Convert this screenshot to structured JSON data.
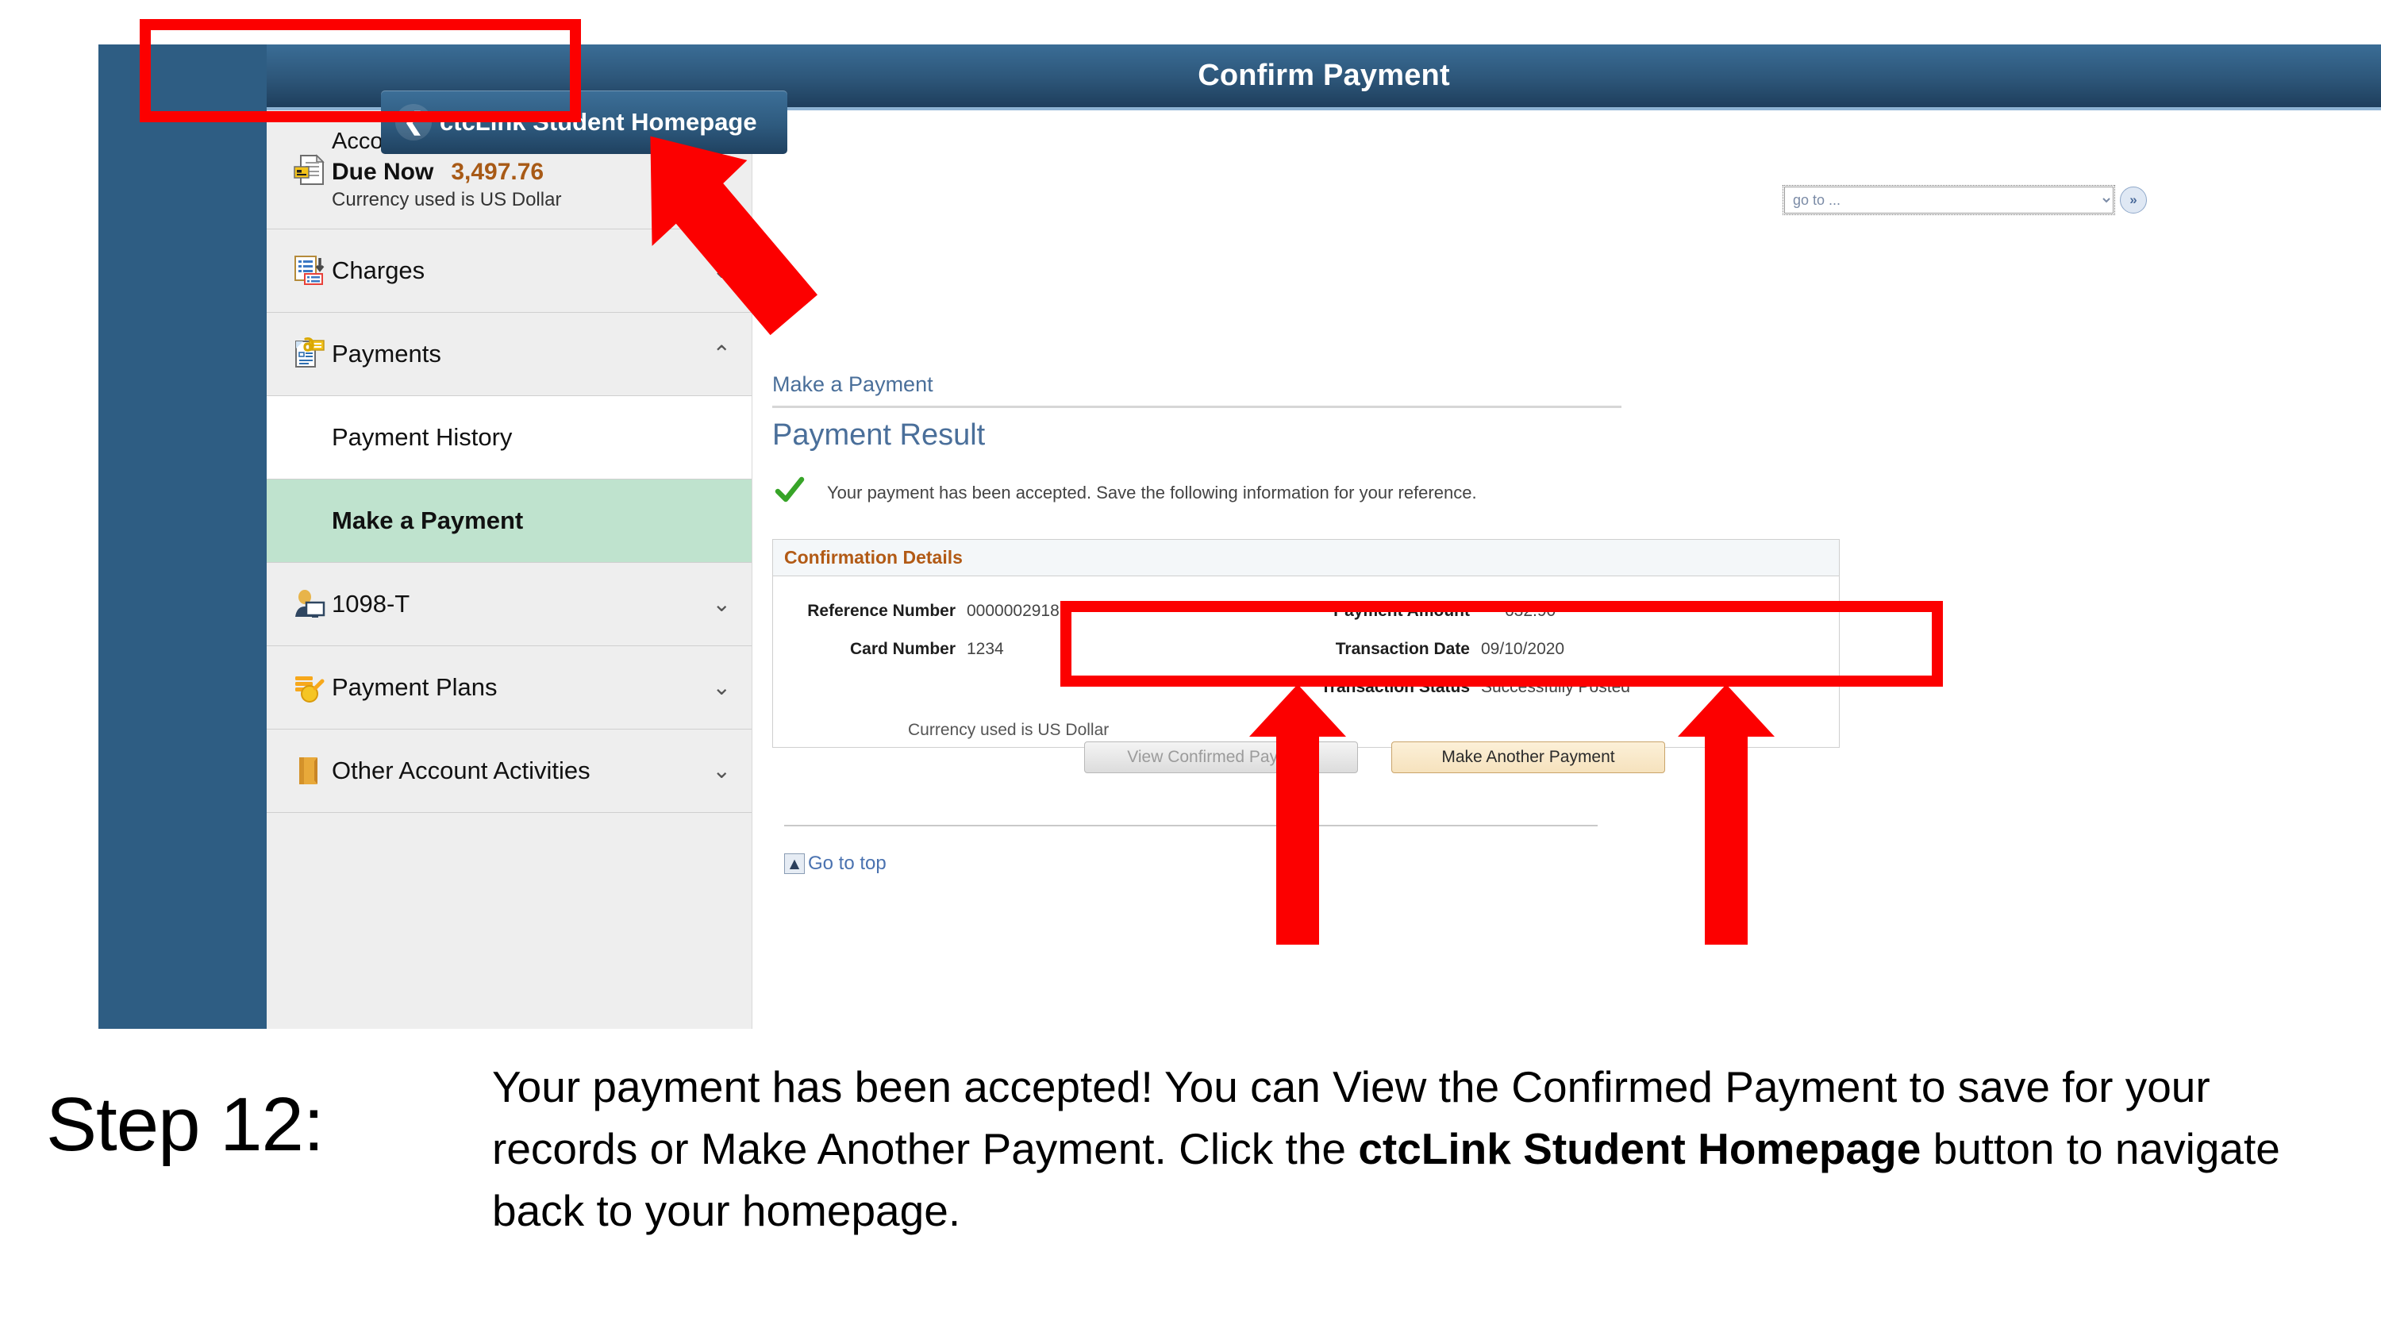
{
  "header": {
    "title": "Confirm Payment",
    "back_button_label": "ctcLink Student Homepage",
    "back_icon": "chevron-left-icon"
  },
  "sidebar": {
    "balance": {
      "title": "Account Balance",
      "due_label": "Due Now",
      "due_amount": "3,497.76",
      "currency_note": "Currency used is US Dollar",
      "icon": "invoice-icon",
      "amount_color": "#a85a16"
    },
    "items": [
      {
        "label": "Charges",
        "icon": "charges-list-icon",
        "chevron": "⌄",
        "expanded": false
      },
      {
        "label": "Payments",
        "icon": "payments-icon",
        "chevron": "⌃",
        "expanded": true
      },
      {
        "label": "1098-T",
        "icon": "person-monitor-icon",
        "chevron": "⌄",
        "expanded": false
      },
      {
        "label": "Payment Plans",
        "icon": "coins-stack-icon",
        "chevron": "⌄",
        "expanded": false
      },
      {
        "label": "Other Account Activities",
        "icon": "folder-icon",
        "chevron": "⌄",
        "expanded": false
      }
    ],
    "sub_items": [
      {
        "label": "Payment History",
        "active": false
      },
      {
        "label": "Make a Payment",
        "active": true
      }
    ],
    "active_highlight_color": "#bfe3ce"
  },
  "main": {
    "go_to": {
      "selected": "go to ...",
      "go_icon": "double-chevron-right-icon"
    },
    "breadcrumb": "Make a Payment",
    "page_title": "Payment Result",
    "status_icon": "green-check-icon",
    "status_message": "Your payment has been accepted. Save the following information for your reference.",
    "confirmation": {
      "panel_title": "Confirmation Details",
      "panel_title_color": "#b25a15",
      "left_fields": [
        {
          "label": "Reference Number",
          "value": "0000002918"
        },
        {
          "label": "Card Number",
          "value": "1234"
        }
      ],
      "right_fields": [
        {
          "label": "Payment Amount",
          "value": "632.90"
        },
        {
          "label": "Transaction Date",
          "value": "09/10/2020"
        },
        {
          "label": "Transaction Status",
          "value": "Successfully Posted"
        }
      ],
      "currency_note": "Currency used is US Dollar"
    },
    "buttons": {
      "view_confirmed": "View Confirmed Payment",
      "make_another": "Make Another Payment"
    },
    "go_to_top": {
      "label": "Go to top",
      "icon": "go-to-top-icon"
    }
  },
  "annotations": {
    "highlight_color": "#fc0000",
    "arrow_count": 3
  },
  "caption": {
    "step_label": "Step 12:",
    "line1_a": "Your payment has been accepted! You can View the Confirmed Payment to ",
    "line1_b": "save for your records or Make Another Payment. Click the ",
    "bold_phrase": "ctcLink Student Homepage",
    "line1_c": " button to navigate back to your homepage."
  }
}
